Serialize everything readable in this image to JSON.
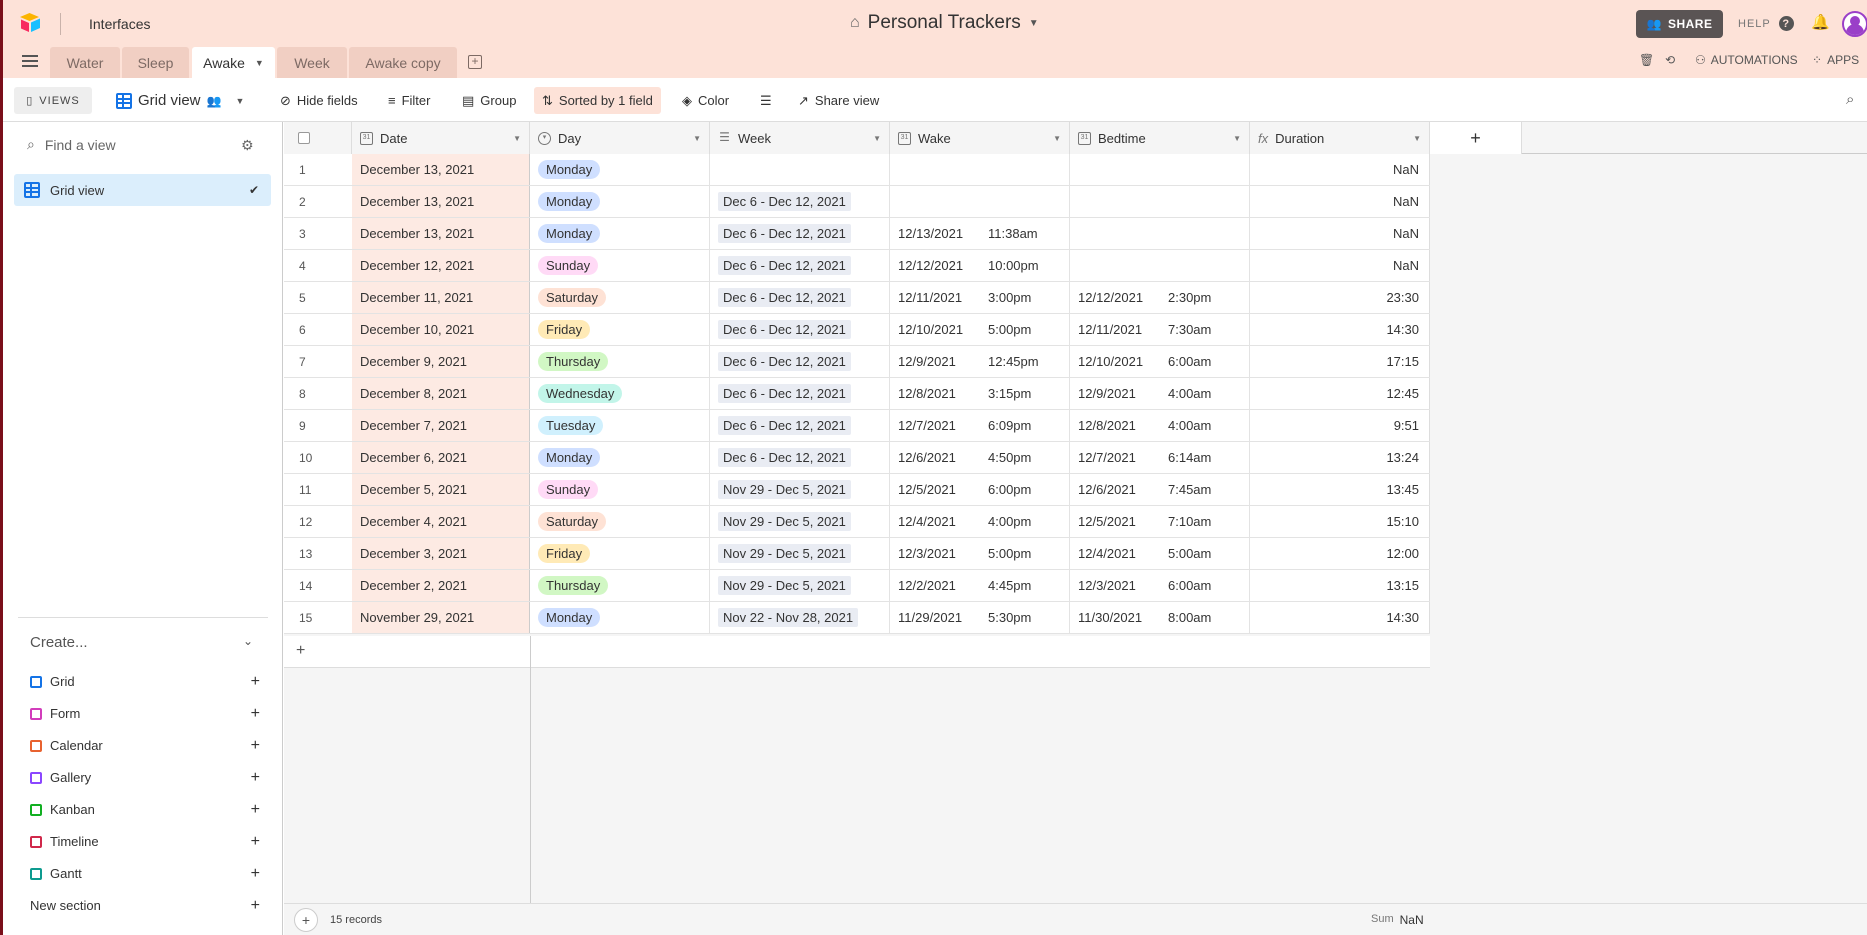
{
  "header": {
    "interfaces_label": "Interfaces",
    "base_title": "Personal Trackers",
    "share_label": "SHARE",
    "help_label": "HELP"
  },
  "tabs": [
    {
      "label": "Water"
    },
    {
      "label": "Sleep"
    },
    {
      "label": "Awake"
    },
    {
      "label": "Week"
    },
    {
      "label": "Awake copy"
    }
  ],
  "right_tools": {
    "automations_label": "AUTOMATIONS",
    "apps_label": "APPS"
  },
  "viewbar": {
    "views_label": "VIEWS",
    "view_name": "Grid view",
    "hide_fields": "Hide fields",
    "filter": "Filter",
    "group": "Group",
    "sorted": "Sorted by 1 field",
    "color": "Color",
    "share_view": "Share view"
  },
  "sidebar": {
    "search_placeholder": "Find a view",
    "active_view": "Grid view",
    "create_label": "Create...",
    "create_items": [
      {
        "label": "Grid",
        "color": "#1473e6"
      },
      {
        "label": "Form",
        "color": "#d23dbb"
      },
      {
        "label": "Calendar",
        "color": "#e8622f"
      },
      {
        "label": "Gallery",
        "color": "#8b46ff"
      },
      {
        "label": "Kanban",
        "color": "#11af22"
      },
      {
        "label": "Timeline",
        "color": "#d0284a"
      },
      {
        "label": "Gantt",
        "color": "#0d9b8f"
      },
      {
        "label": "New section",
        "color": ""
      }
    ]
  },
  "table": {
    "columns": [
      "Date",
      "Day",
      "Week",
      "Wake",
      "Bedtime",
      "Duration"
    ],
    "rows": [
      {
        "n": "1",
        "date": "December 13, 2021",
        "day": "Monday",
        "week": "",
        "wake_d": "",
        "wake_t": "",
        "bed_d": "",
        "bed_t": "",
        "dur": "NaN"
      },
      {
        "n": "2",
        "date": "December 13, 2021",
        "day": "Monday",
        "week": "Dec 6 - Dec 12, 2021",
        "wake_d": "",
        "wake_t": "",
        "bed_d": "",
        "bed_t": "",
        "dur": "NaN"
      },
      {
        "n": "3",
        "date": "December 13, 2021",
        "day": "Monday",
        "week": "Dec 6 - Dec 12, 2021",
        "wake_d": "12/13/2021",
        "wake_t": "11:38am",
        "bed_d": "",
        "bed_t": "",
        "dur": "NaN"
      },
      {
        "n": "4",
        "date": "December 12, 2021",
        "day": "Sunday",
        "week": "Dec 6 - Dec 12, 2021",
        "wake_d": "12/12/2021",
        "wake_t": "10:00pm",
        "bed_d": "",
        "bed_t": "",
        "dur": "NaN"
      },
      {
        "n": "5",
        "date": "December 11, 2021",
        "day": "Saturday",
        "week": "Dec 6 - Dec 12, 2021",
        "wake_d": "12/11/2021",
        "wake_t": "3:00pm",
        "bed_d": "12/12/2021",
        "bed_t": "2:30pm",
        "dur": "23:30"
      },
      {
        "n": "6",
        "date": "December 10, 2021",
        "day": "Friday",
        "week": "Dec 6 - Dec 12, 2021",
        "wake_d": "12/10/2021",
        "wake_t": "5:00pm",
        "bed_d": "12/11/2021",
        "bed_t": "7:30am",
        "dur": "14:30"
      },
      {
        "n": "7",
        "date": "December 9, 2021",
        "day": "Thursday",
        "week": "Dec 6 - Dec 12, 2021",
        "wake_d": "12/9/2021",
        "wake_t": "12:45pm",
        "bed_d": "12/10/2021",
        "bed_t": "6:00am",
        "dur": "17:15"
      },
      {
        "n": "8",
        "date": "December 8, 2021",
        "day": "Wednesday",
        "week": "Dec 6 - Dec 12, 2021",
        "wake_d": "12/8/2021",
        "wake_t": "3:15pm",
        "bed_d": "12/9/2021",
        "bed_t": "4:00am",
        "dur": "12:45"
      },
      {
        "n": "9",
        "date": "December 7, 2021",
        "day": "Tuesday",
        "week": "Dec 6 - Dec 12, 2021",
        "wake_d": "12/7/2021",
        "wake_t": "6:09pm",
        "bed_d": "12/8/2021",
        "bed_t": "4:00am",
        "dur": "9:51"
      },
      {
        "n": "10",
        "date": "December 6, 2021",
        "day": "Monday",
        "week": "Dec 6 - Dec 12, 2021",
        "wake_d": "12/6/2021",
        "wake_t": "4:50pm",
        "bed_d": "12/7/2021",
        "bed_t": "6:14am",
        "dur": "13:24"
      },
      {
        "n": "11",
        "date": "December 5, 2021",
        "day": "Sunday",
        "week": "Nov 29 - Dec 5, 2021",
        "wake_d": "12/5/2021",
        "wake_t": "6:00pm",
        "bed_d": "12/6/2021",
        "bed_t": "7:45am",
        "dur": "13:45"
      },
      {
        "n": "12",
        "date": "December 4, 2021",
        "day": "Saturday",
        "week": "Nov 29 - Dec 5, 2021",
        "wake_d": "12/4/2021",
        "wake_t": "4:00pm",
        "bed_d": "12/5/2021",
        "bed_t": "7:10am",
        "dur": "15:10"
      },
      {
        "n": "13",
        "date": "December 3, 2021",
        "day": "Friday",
        "week": "Nov 29 - Dec 5, 2021",
        "wake_d": "12/3/2021",
        "wake_t": "5:00pm",
        "bed_d": "12/4/2021",
        "bed_t": "5:00am",
        "dur": "12:00"
      },
      {
        "n": "14",
        "date": "December 2, 2021",
        "day": "Thursday",
        "week": "Nov 29 - Dec 5, 2021",
        "wake_d": "12/2/2021",
        "wake_t": "4:45pm",
        "bed_d": "12/3/2021",
        "bed_t": "6:00am",
        "dur": "13:15"
      },
      {
        "n": "15",
        "date": "November 29, 2021",
        "day": "Monday",
        "week": "Nov 22 - Nov 28, 2021",
        "wake_d": "11/29/2021",
        "wake_t": "5:30pm",
        "bed_d": "11/30/2021",
        "bed_t": "8:00am",
        "dur": "14:30"
      }
    ],
    "day_colors": {
      "Monday": "#cfdfff",
      "Sunday": "#ffdaf6",
      "Saturday": "#fee2d5",
      "Friday": "#ffeab6",
      "Thursday": "#d1f7c4",
      "Wednesday": "#c2f5e9",
      "Tuesday": "#d0f0fd"
    }
  },
  "footer": {
    "records": "15 records",
    "sum_label": "Sum",
    "sum_value": "NaN"
  }
}
